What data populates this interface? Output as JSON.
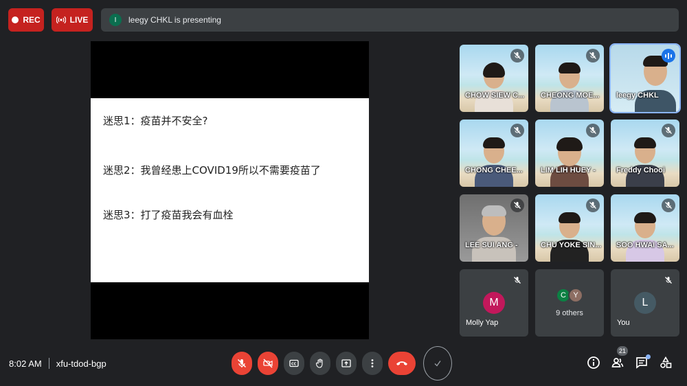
{
  "top": {
    "rec_label": "REC",
    "live_label": "LIVE",
    "presenter_initial": "I",
    "presenting_text": "leegy CHKL is presenting"
  },
  "slide": {
    "lines": [
      "迷思1：疫苗并不安全?",
      "迷思2：我曾经患上COVID19所以不需要疫苗了",
      "迷思3：打了疫苗我会有血栓"
    ]
  },
  "participants": [
    {
      "name": "CHOW SIEW C...",
      "muted": true
    },
    {
      "name": "CHEONG MOE...",
      "muted": true
    },
    {
      "name": "leegy CHKL",
      "muted": false,
      "speaking": true
    },
    {
      "name": "CHONG CHEE...",
      "muted": true
    },
    {
      "name": "LIM LIH HUEY -",
      "muted": true
    },
    {
      "name": "Freddy Chooi",
      "muted": true
    },
    {
      "name": "LEE SUI ANG -",
      "muted": true
    },
    {
      "name": "CHU YOKE SIN...",
      "muted": true
    },
    {
      "name": "SOO HWAI SA...",
      "muted": true
    }
  ],
  "avatar_tiles": {
    "molly": {
      "initial": "M",
      "name": "Molly Yap",
      "color": "#c2185b"
    },
    "others": {
      "initial_1": "C",
      "initial_2": "Y",
      "label": "9 others",
      "color_1": "#0b8043",
      "color_2": "#8d6e63"
    },
    "you": {
      "initial": "L",
      "name": "You",
      "color": "#455a64"
    }
  },
  "bottom": {
    "time": "8:02 AM",
    "meeting_code": "xfu-tdod-bgp",
    "people_count": "21"
  },
  "colors": {
    "danger": "#ea4335",
    "control_bg": "#3c4043",
    "accent": "#8ab4f8"
  }
}
